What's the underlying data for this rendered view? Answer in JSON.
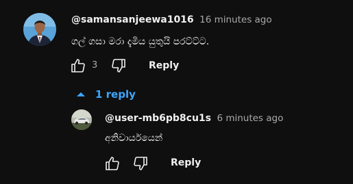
{
  "comment": {
    "author": "@samansanjeewa1016",
    "time": "16 minutes ago",
    "text": "ගල් ගසා මරා දැමිය යුතුයි පරට්ට්ට.",
    "likes": "3",
    "reply_label": "Reply",
    "avatar_icon": "user-avatar-photo"
  },
  "replies_toggle": {
    "label": "1 reply",
    "icon": "caret-up-icon",
    "color": "#3ea6ff"
  },
  "reply": {
    "author": "@user-mb6pb8cu1s",
    "time": "6 minutes ago",
    "text": "අනිවාර්යයෙන්",
    "reply_label": "Reply",
    "avatar_icon": "user-avatar-car-photo"
  },
  "colors": {
    "background": "#0f0f0f",
    "text": "#f1f1f1",
    "secondary": "#aaaaaa",
    "accent": "#3ea6ff"
  }
}
